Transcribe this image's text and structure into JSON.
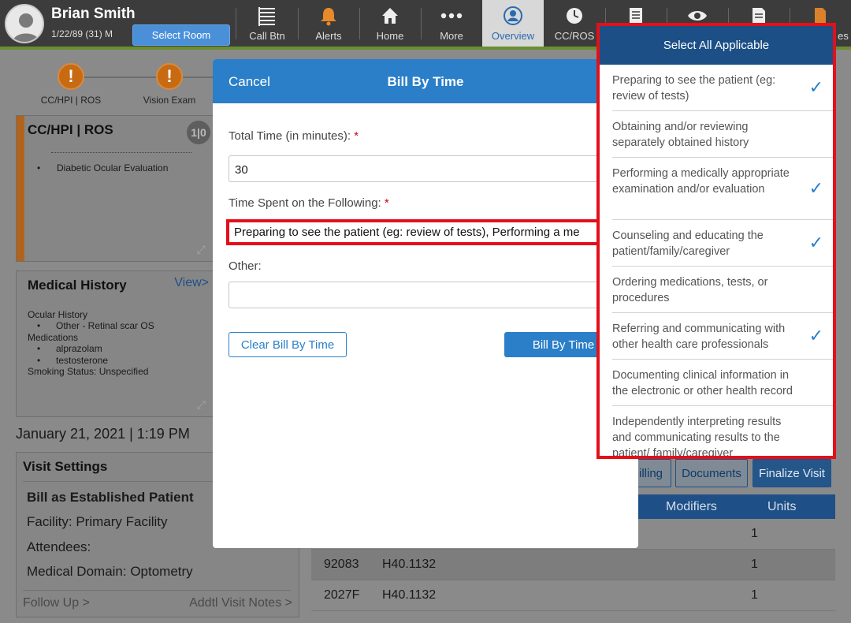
{
  "header": {
    "patient_name": "Brian Smith",
    "patient_dob": "1/22/89 (31) M",
    "select_room_label": "Select Room",
    "nav": [
      {
        "label": "Call Btn",
        "icon": "call-button-icon"
      },
      {
        "label": "Alerts",
        "icon": "bell-icon"
      },
      {
        "label": "Home",
        "icon": "home-icon"
      },
      {
        "label": "More",
        "icon": "more-icon"
      },
      {
        "label": "Overview",
        "icon": "person-icon",
        "active": true
      },
      {
        "label": "CC/ROS",
        "icon": "clock-icon"
      },
      {
        "label": "",
        "icon": "document-icon"
      },
      {
        "label": "",
        "icon": "eye-icon"
      },
      {
        "label": "",
        "icon": "notes-icon"
      },
      {
        "label": "es",
        "icon": "file-icon"
      }
    ]
  },
  "workflow": {
    "steps": [
      {
        "label": "CC/HPI | ROS",
        "status": "!"
      },
      {
        "label": "Vision Exam",
        "status": "!"
      }
    ]
  },
  "cc_card": {
    "title": "CC/HPI | ROS",
    "badge": "1|0",
    "items": [
      "Diabetic Ocular Evaluation"
    ]
  },
  "medical_history": {
    "title": "Medical History",
    "link": "View>",
    "lines": [
      "Ocular History",
      "Other - Retinal scar OS",
      "Medications",
      "alprazolam",
      "testosterone",
      "Smoking Status: Unspecified"
    ]
  },
  "visit": {
    "date": "January 21, 2021 | 1:19 PM",
    "settings_title": "Visit Settings",
    "bill_type": "Bill as Established Patient",
    "facility": "Facility: Primary Facility",
    "attendees": "Attendees:",
    "domain": "Medical Domain: Optometry",
    "follow_up": "Follow Up >",
    "addtl_notes": "Addtl Visit Notes >"
  },
  "actions": {
    "billing": "Billing",
    "documents": "Documents",
    "finalize": "Finalize Visit"
  },
  "billing_table": {
    "headers": {
      "modifiers": "Modifiers",
      "units": "Units"
    },
    "rows": [
      {
        "code": "",
        "dx": "",
        "units": "1"
      },
      {
        "code": "92083",
        "dx": "H40.1132",
        "units": "1"
      },
      {
        "code": "2027F",
        "dx": "H40.1132",
        "units": "1"
      }
    ]
  },
  "modal": {
    "cancel": "Cancel",
    "title": "Bill By Time",
    "total_time_label": "Total Time (in minutes):",
    "required_mark": "*",
    "total_time_value": "30",
    "time_spent_label": "Time Spent on the Following:",
    "time_spent_value": "Preparing to see the patient (eg: review of tests), Performing a me",
    "other_label": "Other:",
    "other_value": "",
    "clear_button": "Clear Bill By Time",
    "bill_button": "Bill By Time"
  },
  "select_popover": {
    "title": "Select All Applicable",
    "options": [
      {
        "text": "Preparing to see the patient (eg: review of tests)",
        "checked": true
      },
      {
        "text": "Obtaining and/or reviewing separately obtained history",
        "checked": false
      },
      {
        "text": "Performing a medically appropriate examination and/or evaluation",
        "checked": true
      },
      {
        "text": "Counseling and educating the patient/family/caregiver",
        "checked": true
      },
      {
        "text": "Ordering medications, tests, or procedures",
        "checked": false
      },
      {
        "text": "Referring and communicating with other health care professionals",
        "checked": true
      },
      {
        "text": "Documenting clinical information in the electronic or other health record",
        "checked": false
      },
      {
        "text": "Independently interpreting results and communicating results to the patient/ family/caregiver",
        "checked": false
      }
    ]
  },
  "colors": {
    "primary_blue": "#2a7fc8",
    "header_dark_blue": "#1c4f86",
    "alert_orange": "#c76a12",
    "annotation_red": "#e3101a"
  }
}
